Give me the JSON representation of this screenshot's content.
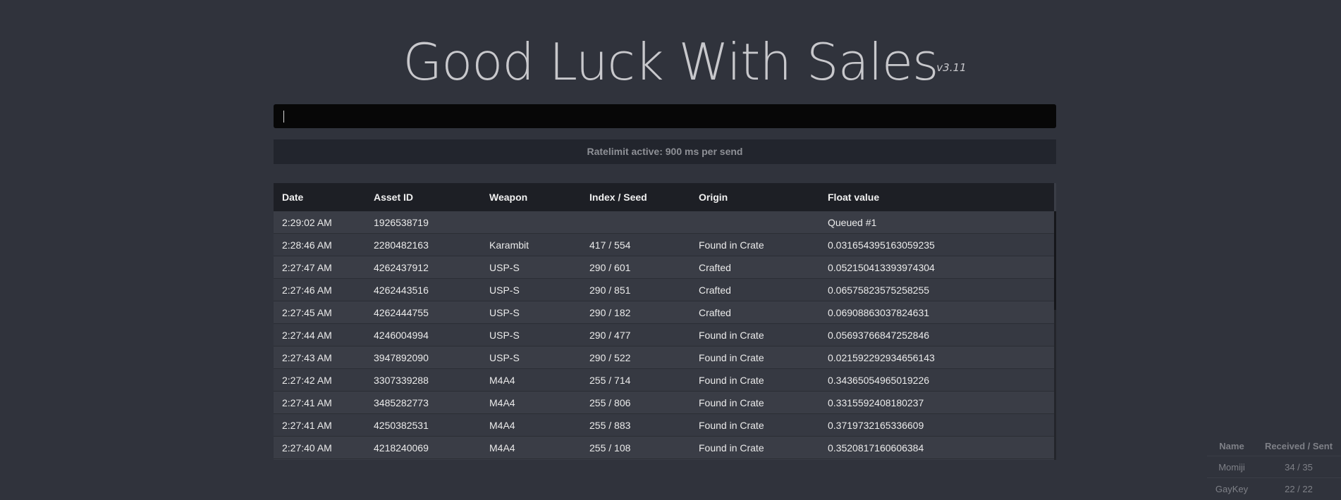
{
  "header": {
    "title": "Good Luck With Sales",
    "version": "v3.11"
  },
  "search": {
    "value": "",
    "placeholder": ""
  },
  "ratelimit": {
    "text": "Ratelimit active: 900 ms per send"
  },
  "table": {
    "columns": [
      "Date",
      "Asset ID",
      "Weapon",
      "Index / Seed",
      "Origin",
      "Float value"
    ],
    "rows": [
      [
        "2:29:02 AM",
        "1926538719",
        "",
        "",
        "",
        "Queued #1"
      ],
      [
        "2:28:46 AM",
        "2280482163",
        "Karambit",
        "417 / 554",
        "Found in Crate",
        "0.031654395163059235"
      ],
      [
        "2:27:47 AM",
        "4262437912",
        "USP-S",
        "290 / 601",
        "Crafted",
        "0.052150413393974304"
      ],
      [
        "2:27:46 AM",
        "4262443516",
        "USP-S",
        "290 / 851",
        "Crafted",
        "0.06575823575258255"
      ],
      [
        "2:27:45 AM",
        "4262444755",
        "USP-S",
        "290 / 182",
        "Crafted",
        "0.06908863037824631"
      ],
      [
        "2:27:44 AM",
        "4246004994",
        "USP-S",
        "290 / 477",
        "Found in Crate",
        "0.05693766847252846"
      ],
      [
        "2:27:43 AM",
        "3947892090",
        "USP-S",
        "290 / 522",
        "Found in Crate",
        "0.021592292934656143"
      ],
      [
        "2:27:42 AM",
        "3307339288",
        "M4A4",
        "255 / 714",
        "Found in Crate",
        "0.34365054965019226"
      ],
      [
        "2:27:41 AM",
        "3485282773",
        "M4A4",
        "255 / 806",
        "Found in Crate",
        "0.3315592408180237"
      ],
      [
        "2:27:41 AM",
        "4250382531",
        "M4A4",
        "255 / 883",
        "Found in Crate",
        "0.3719732165336609"
      ],
      [
        "2:27:40 AM",
        "4218240069",
        "M4A4",
        "255 / 108",
        "Found in Crate",
        "0.3520817160606384"
      ]
    ]
  },
  "peers": {
    "columns": [
      "Name",
      "Received / Sent"
    ],
    "rows": [
      [
        "Momiji",
        "34 / 35"
      ],
      [
        "GayKey",
        "22 / 22"
      ]
    ]
  },
  "colors": {
    "background": "#30333c",
    "input_background": "#070707",
    "table_header": "#1d1f25",
    "row": "#3a3d46"
  }
}
